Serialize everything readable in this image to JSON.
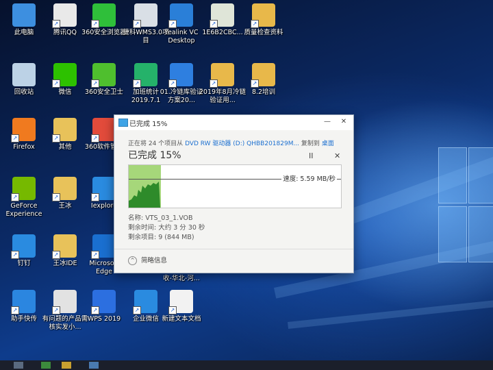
{
  "desktop_icons": [
    {
      "label": "此电脑",
      "icon": "this-pc-icon",
      "color": "#3d8fe0"
    },
    {
      "label": "腾讯QQ",
      "icon": "qq-penguin-icon",
      "color": "#e9e9e9"
    },
    {
      "label": "360安全浏览器",
      "icon": "360-browser-icon",
      "color": "#2fbf3a"
    },
    {
      "label": "捷科WMS3.0项目",
      "icon": "folder-window-icon",
      "color": "#d9dfe6"
    },
    {
      "label": "Yealink VC Desktop",
      "icon": "yealink-icon",
      "color": "#2a7fd8"
    },
    {
      "label": "1E6B2CBC...",
      "icon": "image-file-icon",
      "color": "#dfe5d8"
    },
    {
      "label": "质量检查资料",
      "icon": "folder-icon",
      "color": "#e8b84a"
    },
    {
      "label": "回收站",
      "icon": "recycle-bin-icon",
      "color": "#bcd2e6"
    },
    {
      "label": "微信",
      "icon": "wechat-icon",
      "color": "#2dc100"
    },
    {
      "label": "360安全卫士",
      "icon": "360-safe-icon",
      "color": "#4fbf2e"
    },
    {
      "label": "加班统计2019.7.1",
      "icon": "spreadsheet-s-icon",
      "color": "#25b26a"
    },
    {
      "label": "01.冷链库验证方案20...",
      "icon": "word-w-icon",
      "color": "#2e7fe0"
    },
    {
      "label": "2019年8月冷链验证用...",
      "icon": "folder-docs-icon",
      "color": "#e8b84a"
    },
    {
      "label": "8.2培训",
      "icon": "folder-icon",
      "color": "#e8b84a"
    },
    {
      "label": "Firefox",
      "icon": "firefox-icon",
      "color": "#f07a1f"
    },
    {
      "label": "其他",
      "icon": "folder-icon",
      "color": "#e8c25a"
    },
    {
      "label": "360软件管家",
      "icon": "360-software-icon",
      "color": "#e24b3b"
    },
    {
      "label": "GeForce Experience",
      "icon": "nvidia-icon",
      "color": "#76b900"
    },
    {
      "label": "王冰",
      "icon": "folder-icon",
      "color": "#e8c25a"
    },
    {
      "label": "Iexplore",
      "icon": "ie-icon",
      "color": "#2a8be0"
    },
    {
      "label": "钉钉",
      "icon": "dingtalk-icon",
      "color": "#2a8be0"
    },
    {
      "label": "王冰IDE",
      "icon": "folder-icon",
      "color": "#e8c25a"
    },
    {
      "label": "Microsoft Edge",
      "icon": "edge-icon",
      "color": "#1a6fd0"
    },
    {
      "label": "助手快传",
      "icon": "transfer-icon",
      "color": "#2b86e0"
    },
    {
      "label": "有问题的产品需核实发小...",
      "icon": "doc-pdf-icon",
      "color": "#e2e2e2"
    },
    {
      "label": "WPS 2019",
      "icon": "wps-icon",
      "color": "#2c6fe0"
    },
    {
      "label": "企业微信",
      "icon": "wecom-icon",
      "color": "#2a8be0"
    },
    {
      "label": "新建文本文档",
      "icon": "text-file-icon",
      "color": "#f2f2f2"
    }
  ],
  "partial_label": "收-华北-河...",
  "dialog": {
    "title": "已完成 15%",
    "line_prefix": "正在将 24 个项目从",
    "line_source": "DVD RW 驱动器 (D:) QHBB201829M...",
    "line_mid": "复制到",
    "line_dest": "桌面",
    "percent_text": "已完成 15%",
    "pause_symbol": "II",
    "close_symbol": "✕",
    "progress_fraction": 0.15,
    "speed_label": "速度: 5.59 MB/秒",
    "name_line": "名称: VTS_03_1.VOB",
    "time_line": "剩余时间: 大约 3 分 30 秒",
    "items_line": "剩余项目: 9 (844 MB)",
    "less_details": "简略信息",
    "minimize_symbol": "—",
    "close_window_symbol": "✕"
  }
}
